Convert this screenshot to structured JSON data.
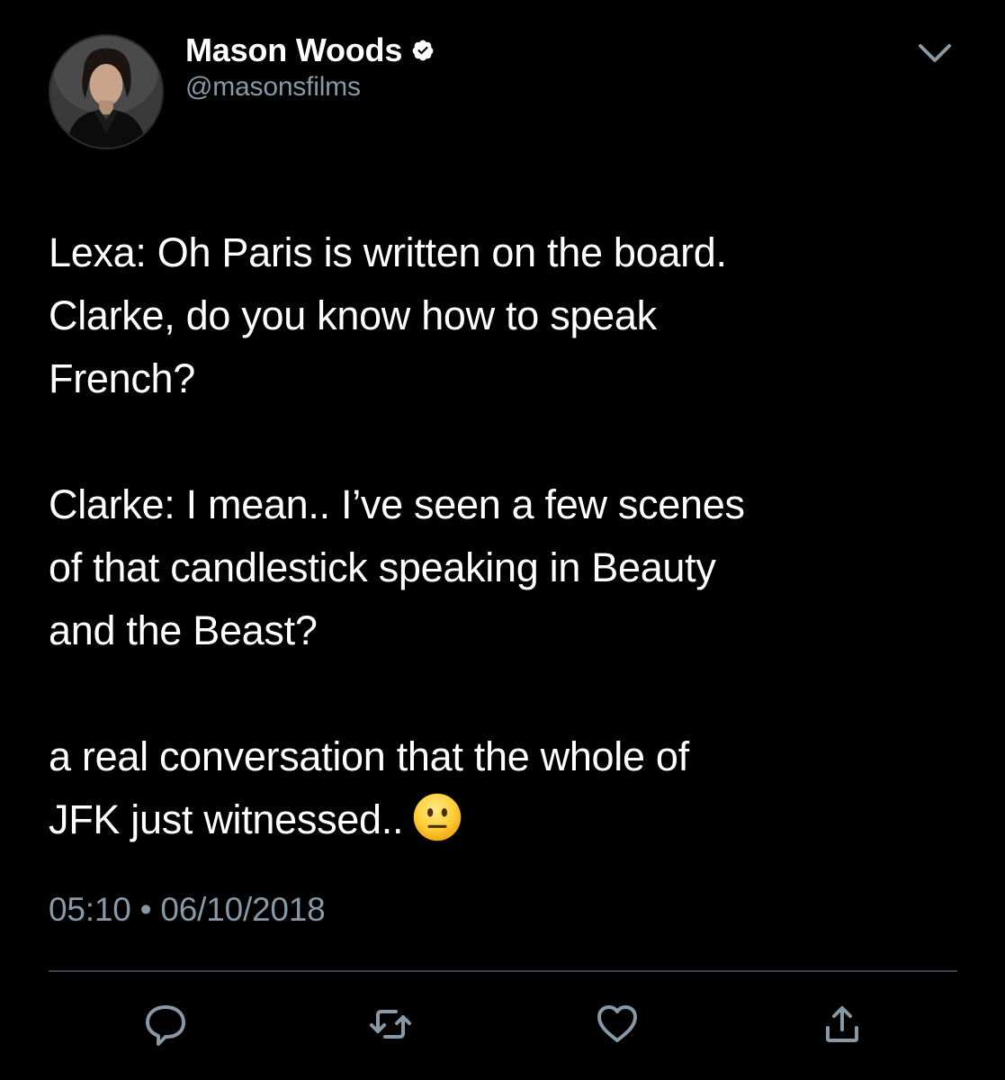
{
  "user": {
    "display_name": "Mason Woods",
    "handle": "@masonsfilms",
    "verified": true
  },
  "tweet": {
    "paragraphs": [
      "Lexa: Oh Paris is written on the board.\nClarke, do you know how to speak\nFrench?",
      "Clarke: I mean.. I’ve seen a few scenes\nof that candlestick speaking in Beauty\nand the Beast?",
      "a real conversation that the whole of\nJFK just witnessed.."
    ],
    "emoji": "neutral-face-emoji"
  },
  "timestamp": {
    "time": "05:10",
    "separator": "•",
    "date": "06/10/2018"
  },
  "icons": {
    "menu": "chevron-down-icon",
    "reply": "reply-icon",
    "retweet": "retweet-icon",
    "like": "heart-icon",
    "share": "share-icon",
    "verified": "verified-badge-icon"
  },
  "colors": {
    "background": "#000000",
    "text": "#ffffff",
    "secondary": "#8899a6",
    "divider": "#38444d",
    "accent": "#1da1f2"
  }
}
